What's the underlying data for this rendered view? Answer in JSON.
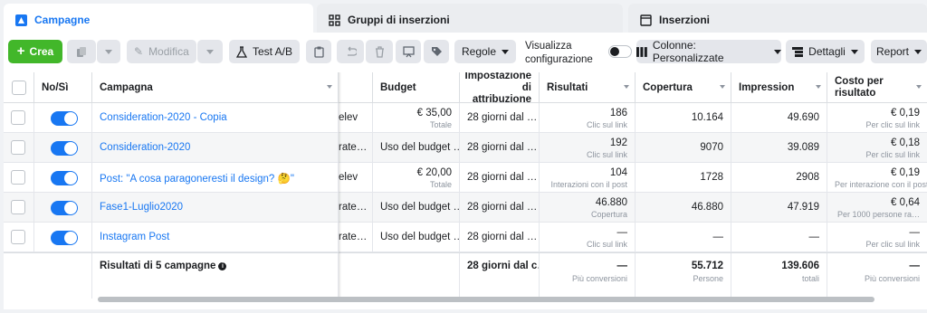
{
  "tabs": [
    {
      "label": "Campagne",
      "icon": "campaign-icon"
    },
    {
      "label": "Gruppi di inserzioni",
      "icon": "grid-icon"
    },
    {
      "label": "Inserzioni",
      "icon": "window-icon"
    }
  ],
  "toolbar": {
    "create": "Crea",
    "edit": "Modifica",
    "ab_test": "Test A/B",
    "rules": "Regole",
    "view_config": "Visualizza configurazione",
    "columns": "Colonne: Personalizzate",
    "breakdown": "Dettagli",
    "report": "Report"
  },
  "columns": {
    "onoff": "No/Sì",
    "campaign": "Campagna",
    "budget": "Budget",
    "attribution": "Impostazione di attribuzione",
    "results": "Risultati",
    "reach": "Copertura",
    "impressions": "Impression",
    "cost": "Costo per risultato"
  },
  "rows": [
    {
      "name": "Consideration-2020 - Copia",
      "delivery": "elev",
      "budget": "€ 35,00",
      "budget_sub": "Totale",
      "attribution": "28 giorni dal …",
      "results": "186",
      "results_sub": "Clic sul link",
      "reach": "10.164",
      "impressions": "49.690",
      "cost": "€ 0,19",
      "cost_sub": "Per clic sul link"
    },
    {
      "name": "Consideration-2020",
      "delivery": "rate…",
      "budget": "Uso del budget …",
      "budget_sub": "",
      "attribution": "28 giorni dal …",
      "results": "192",
      "results_sub": "Clic sul link",
      "reach": "9070",
      "impressions": "39.089",
      "cost": "€ 0,18",
      "cost_sub": "Per clic sul link"
    },
    {
      "name": "Post: \"A cosa paragoneresti il design? 🤔\"",
      "delivery": "elev",
      "budget": "€ 20,00",
      "budget_sub": "Totale",
      "attribution": "28 giorni dal …",
      "results": "104",
      "results_sub": "Interazioni con il post",
      "reach": "1728",
      "impressions": "2908",
      "cost": "€ 0,19",
      "cost_sub": "Per interazione con il post"
    },
    {
      "name": "Fase1-Luglio2020",
      "delivery": "rate…",
      "budget": "Uso del budget …",
      "budget_sub": "",
      "attribution": "28 giorni dal …",
      "results": "46.880",
      "results_sub": "Copertura",
      "reach": "46.880",
      "impressions": "47.919",
      "cost": "€ 0,64",
      "cost_sub": "Per 1000 persone ra…"
    },
    {
      "name": "Instagram Post",
      "delivery": "rate…",
      "budget": "Uso del budget …",
      "budget_sub": "",
      "attribution": "28 giorni dal …",
      "results": "—",
      "results_sub": "Clic sul link",
      "reach": "—",
      "impressions": "—",
      "cost": "—",
      "cost_sub": "Per clic sul link"
    }
  ],
  "summary": {
    "label": "Risultati di 5 campagne",
    "attribution": "28 giorni dal c…",
    "results": "—",
    "results_sub": "Più conversioni",
    "reach": "55.712",
    "reach_sub": "Persone",
    "impressions": "139.606",
    "impressions_sub": "totali",
    "cost": "—",
    "cost_sub": "Più conversioni"
  },
  "colors": {
    "accent": "#1877f2",
    "create": "#42b72a"
  }
}
